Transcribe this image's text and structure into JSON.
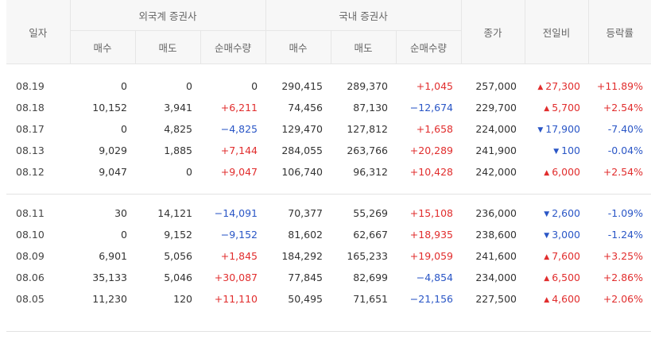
{
  "headers": {
    "date": "일자",
    "foreign_group": "외국계 증권사",
    "domestic_group": "국내 증권사",
    "buy": "매수",
    "sell": "매도",
    "net": "순매수량",
    "close": "종가",
    "change": "전일비",
    "rate": "등락률"
  },
  "group1": [
    {
      "date": "08.19",
      "f_buy": "0",
      "f_sell": "0",
      "f_net": "0",
      "f_net_dir": "none",
      "d_buy": "290,415",
      "d_sell": "289,370",
      "d_net": "+1,045",
      "d_net_dir": "pos",
      "close": "257,000",
      "chg": "27,300",
      "chg_dir": "up",
      "rate": "+11.89%",
      "rate_dir": "pos"
    },
    {
      "date": "08.18",
      "f_buy": "10,152",
      "f_sell": "3,941",
      "f_net": "+6,211",
      "f_net_dir": "pos",
      "d_buy": "74,456",
      "d_sell": "87,130",
      "d_net": "−12,674",
      "d_net_dir": "neg",
      "close": "229,700",
      "chg": "5,700",
      "chg_dir": "up",
      "rate": "+2.54%",
      "rate_dir": "pos"
    },
    {
      "date": "08.17",
      "f_buy": "0",
      "f_sell": "4,825",
      "f_net": "−4,825",
      "f_net_dir": "neg",
      "d_buy": "129,470",
      "d_sell": "127,812",
      "d_net": "+1,658",
      "d_net_dir": "pos",
      "close": "224,000",
      "chg": "17,900",
      "chg_dir": "down",
      "rate": "-7.40%",
      "rate_dir": "neg"
    },
    {
      "date": "08.13",
      "f_buy": "9,029",
      "f_sell": "1,885",
      "f_net": "+7,144",
      "f_net_dir": "pos",
      "d_buy": "284,055",
      "d_sell": "263,766",
      "d_net": "+20,289",
      "d_net_dir": "pos",
      "close": "241,900",
      "chg": "100",
      "chg_dir": "down",
      "rate": "-0.04%",
      "rate_dir": "neg"
    },
    {
      "date": "08.12",
      "f_buy": "9,047",
      "f_sell": "0",
      "f_net": "+9,047",
      "f_net_dir": "pos",
      "d_buy": "106,740",
      "d_sell": "96,312",
      "d_net": "+10,428",
      "d_net_dir": "pos",
      "close": "242,000",
      "chg": "6,000",
      "chg_dir": "up",
      "rate": "+2.54%",
      "rate_dir": "pos"
    }
  ],
  "group2": [
    {
      "date": "08.11",
      "f_buy": "30",
      "f_sell": "14,121",
      "f_net": "−14,091",
      "f_net_dir": "neg",
      "d_buy": "70,377",
      "d_sell": "55,269",
      "d_net": "+15,108",
      "d_net_dir": "pos",
      "close": "236,000",
      "chg": "2,600",
      "chg_dir": "down",
      "rate": "-1.09%",
      "rate_dir": "neg"
    },
    {
      "date": "08.10",
      "f_buy": "0",
      "f_sell": "9,152",
      "f_net": "−9,152",
      "f_net_dir": "neg",
      "d_buy": "81,602",
      "d_sell": "62,667",
      "d_net": "+18,935",
      "d_net_dir": "pos",
      "close": "238,600",
      "chg": "3,000",
      "chg_dir": "down",
      "rate": "-1.24%",
      "rate_dir": "neg"
    },
    {
      "date": "08.09",
      "f_buy": "6,901",
      "f_sell": "5,056",
      "f_net": "+1,845",
      "f_net_dir": "pos",
      "d_buy": "184,292",
      "d_sell": "165,233",
      "d_net": "+19,059",
      "d_net_dir": "pos",
      "close": "241,600",
      "chg": "7,600",
      "chg_dir": "up",
      "rate": "+3.25%",
      "rate_dir": "pos"
    },
    {
      "date": "08.06",
      "f_buy": "35,133",
      "f_sell": "5,046",
      "f_net": "+30,087",
      "f_net_dir": "pos",
      "d_buy": "77,845",
      "d_sell": "82,699",
      "d_net": "−4,854",
      "d_net_dir": "neg",
      "close": "234,000",
      "chg": "6,500",
      "chg_dir": "up",
      "rate": "+2.86%",
      "rate_dir": "pos"
    },
    {
      "date": "08.05",
      "f_buy": "11,230",
      "f_sell": "120",
      "f_net": "+11,110",
      "f_net_dir": "pos",
      "d_buy": "50,495",
      "d_sell": "71,651",
      "d_net": "−21,156",
      "d_net_dir": "neg",
      "close": "227,500",
      "chg": "4,600",
      "chg_dir": "up",
      "rate": "+2.06%",
      "rate_dir": "pos"
    }
  ],
  "icons": {
    "up": "triangle-up-icon",
    "down": "triangle-down-icon"
  },
  "colors": {
    "up": "#e12d2d",
    "down": "#2a56c6",
    "header_bg": "#f7f7f7"
  }
}
